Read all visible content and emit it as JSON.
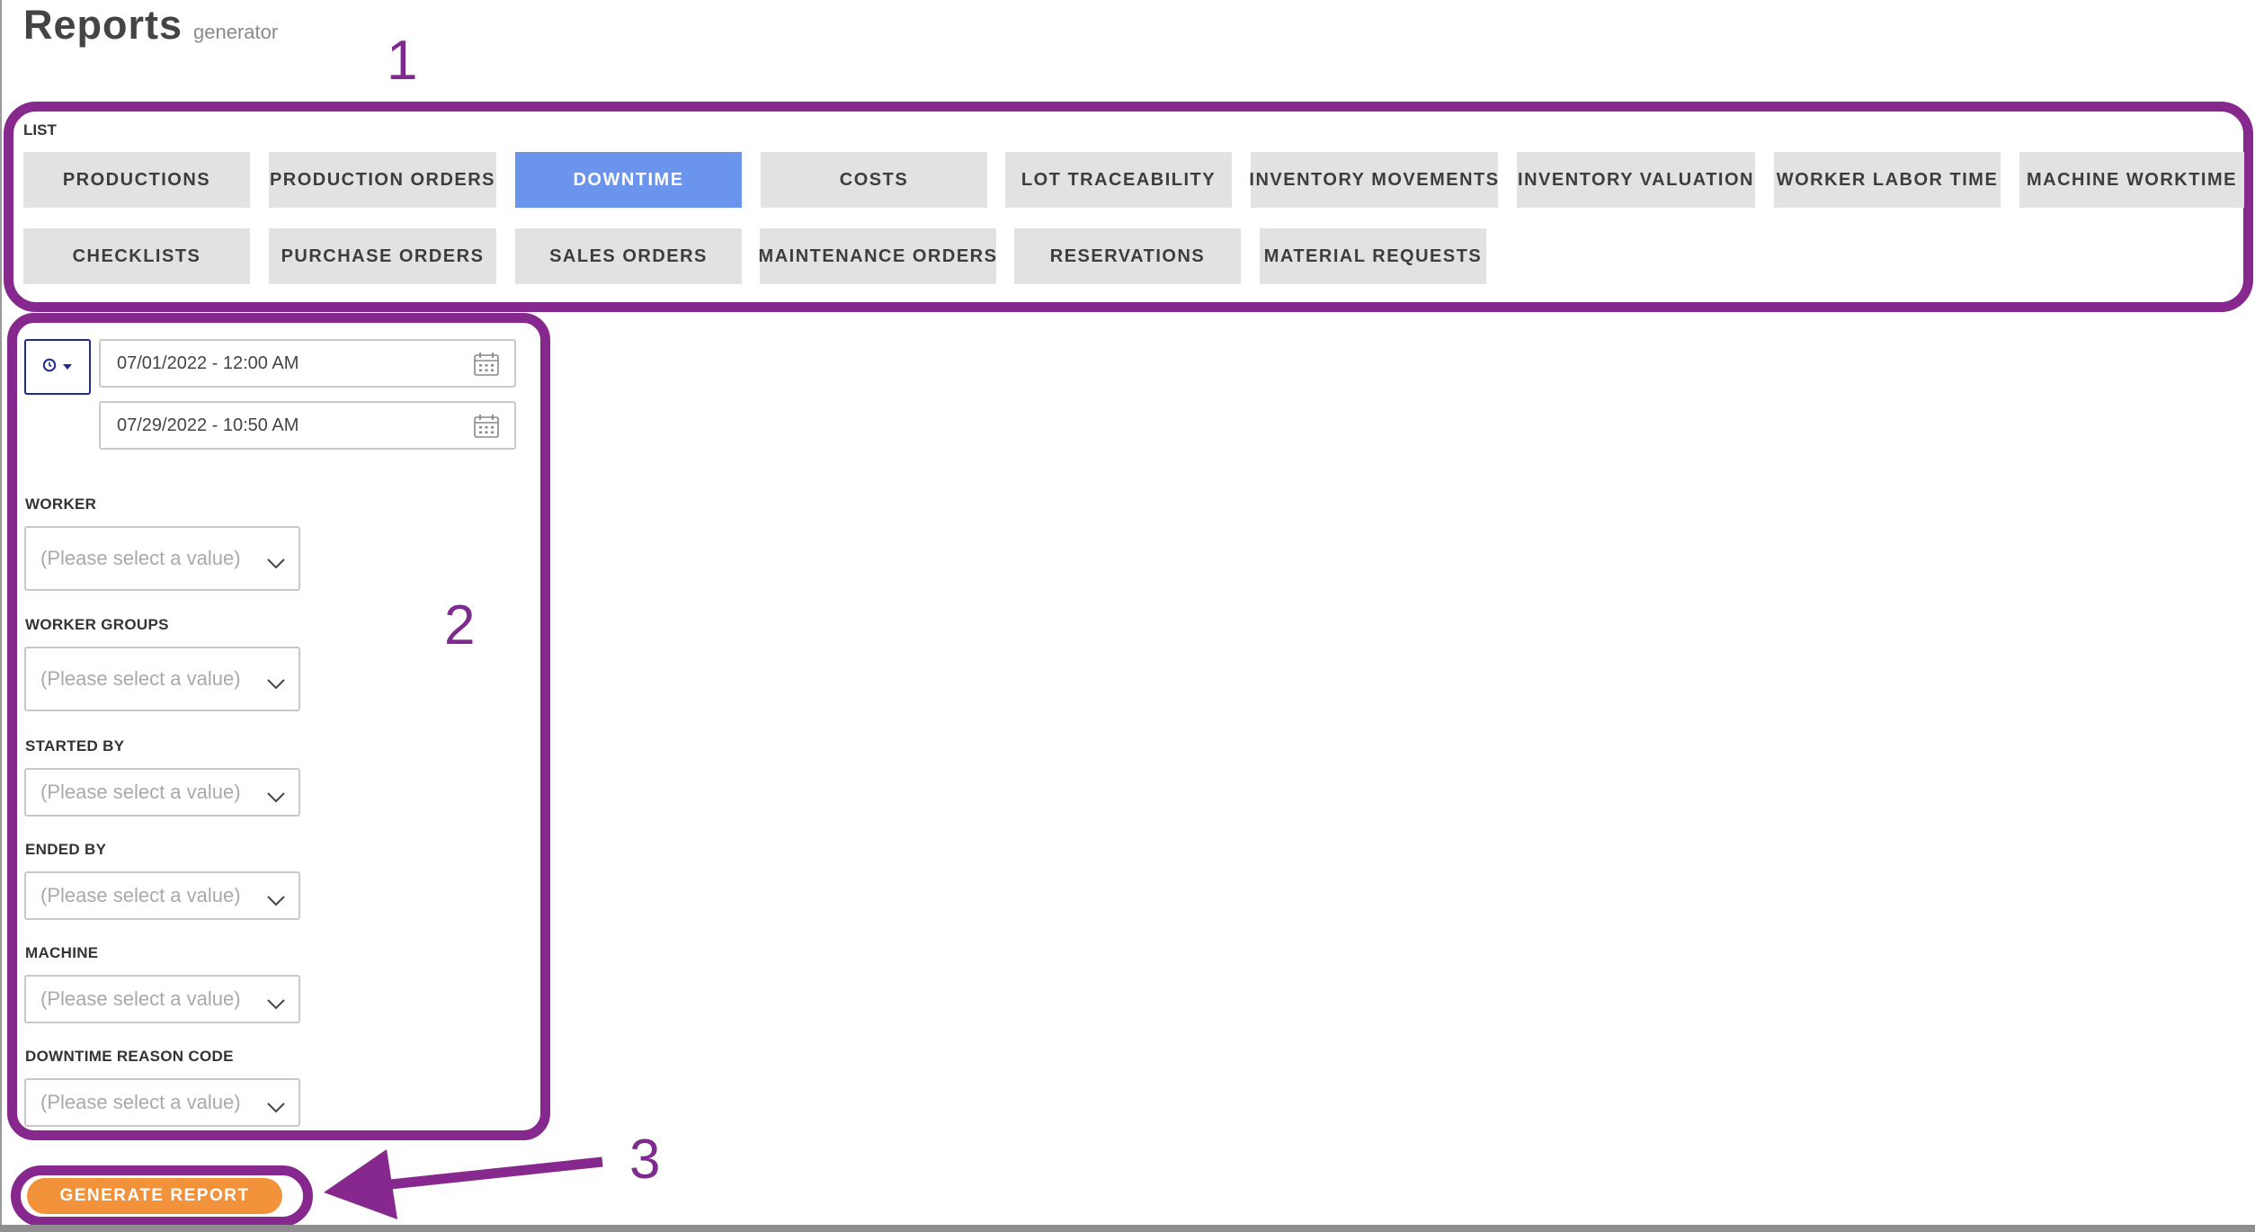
{
  "page": {
    "title": "Reports",
    "subtitle": "generator"
  },
  "annotations": {
    "n1": "1",
    "n2": "2",
    "n3": "3"
  },
  "report_types": {
    "label": "LIST",
    "items": [
      {
        "label": "PRODUCTIONS",
        "active": false
      },
      {
        "label": "PRODUCTION ORDERS",
        "active": false
      },
      {
        "label": "DOWNTIME",
        "active": true
      },
      {
        "label": "COSTS",
        "active": false
      },
      {
        "label": "LOT TRACEABILITY",
        "active": false
      },
      {
        "label": "INVENTORY MOVEMENTS",
        "active": false
      },
      {
        "label": "INVENTORY VALUATION",
        "active": false
      },
      {
        "label": "WORKER LABOR TIME",
        "active": false
      },
      {
        "label": "MACHINE WORKTIME",
        "active": false
      },
      {
        "label": "CHECKLISTS",
        "active": false
      },
      {
        "label": "PURCHASE ORDERS",
        "active": false
      },
      {
        "label": "SALES ORDERS",
        "active": false
      },
      {
        "label": "MAINTENANCE ORDERS",
        "active": false
      },
      {
        "label": "RESERVATIONS",
        "active": false
      },
      {
        "label": "MATERIAL REQUESTS",
        "active": false
      }
    ]
  },
  "filters": {
    "date_from": "07/01/2022 - 12:00 AM",
    "date_to": "07/29/2022 - 10:50 AM",
    "placeholder": "(Please select a value)",
    "fields": [
      {
        "label": "WORKER"
      },
      {
        "label": "WORKER GROUPS"
      },
      {
        "label": "STARTED BY"
      },
      {
        "label": "ENDED BY"
      },
      {
        "label": "MACHINE"
      },
      {
        "label": "DOWNTIME REASON CODE"
      }
    ]
  },
  "generate_button": "GENERATE REPORT",
  "colors": {
    "highlight": "#86288d",
    "active_tab": "#6b95ec",
    "tab_bg": "#e2e2e2",
    "generate": "#f2923a",
    "clock_border": "#1e2b93"
  }
}
